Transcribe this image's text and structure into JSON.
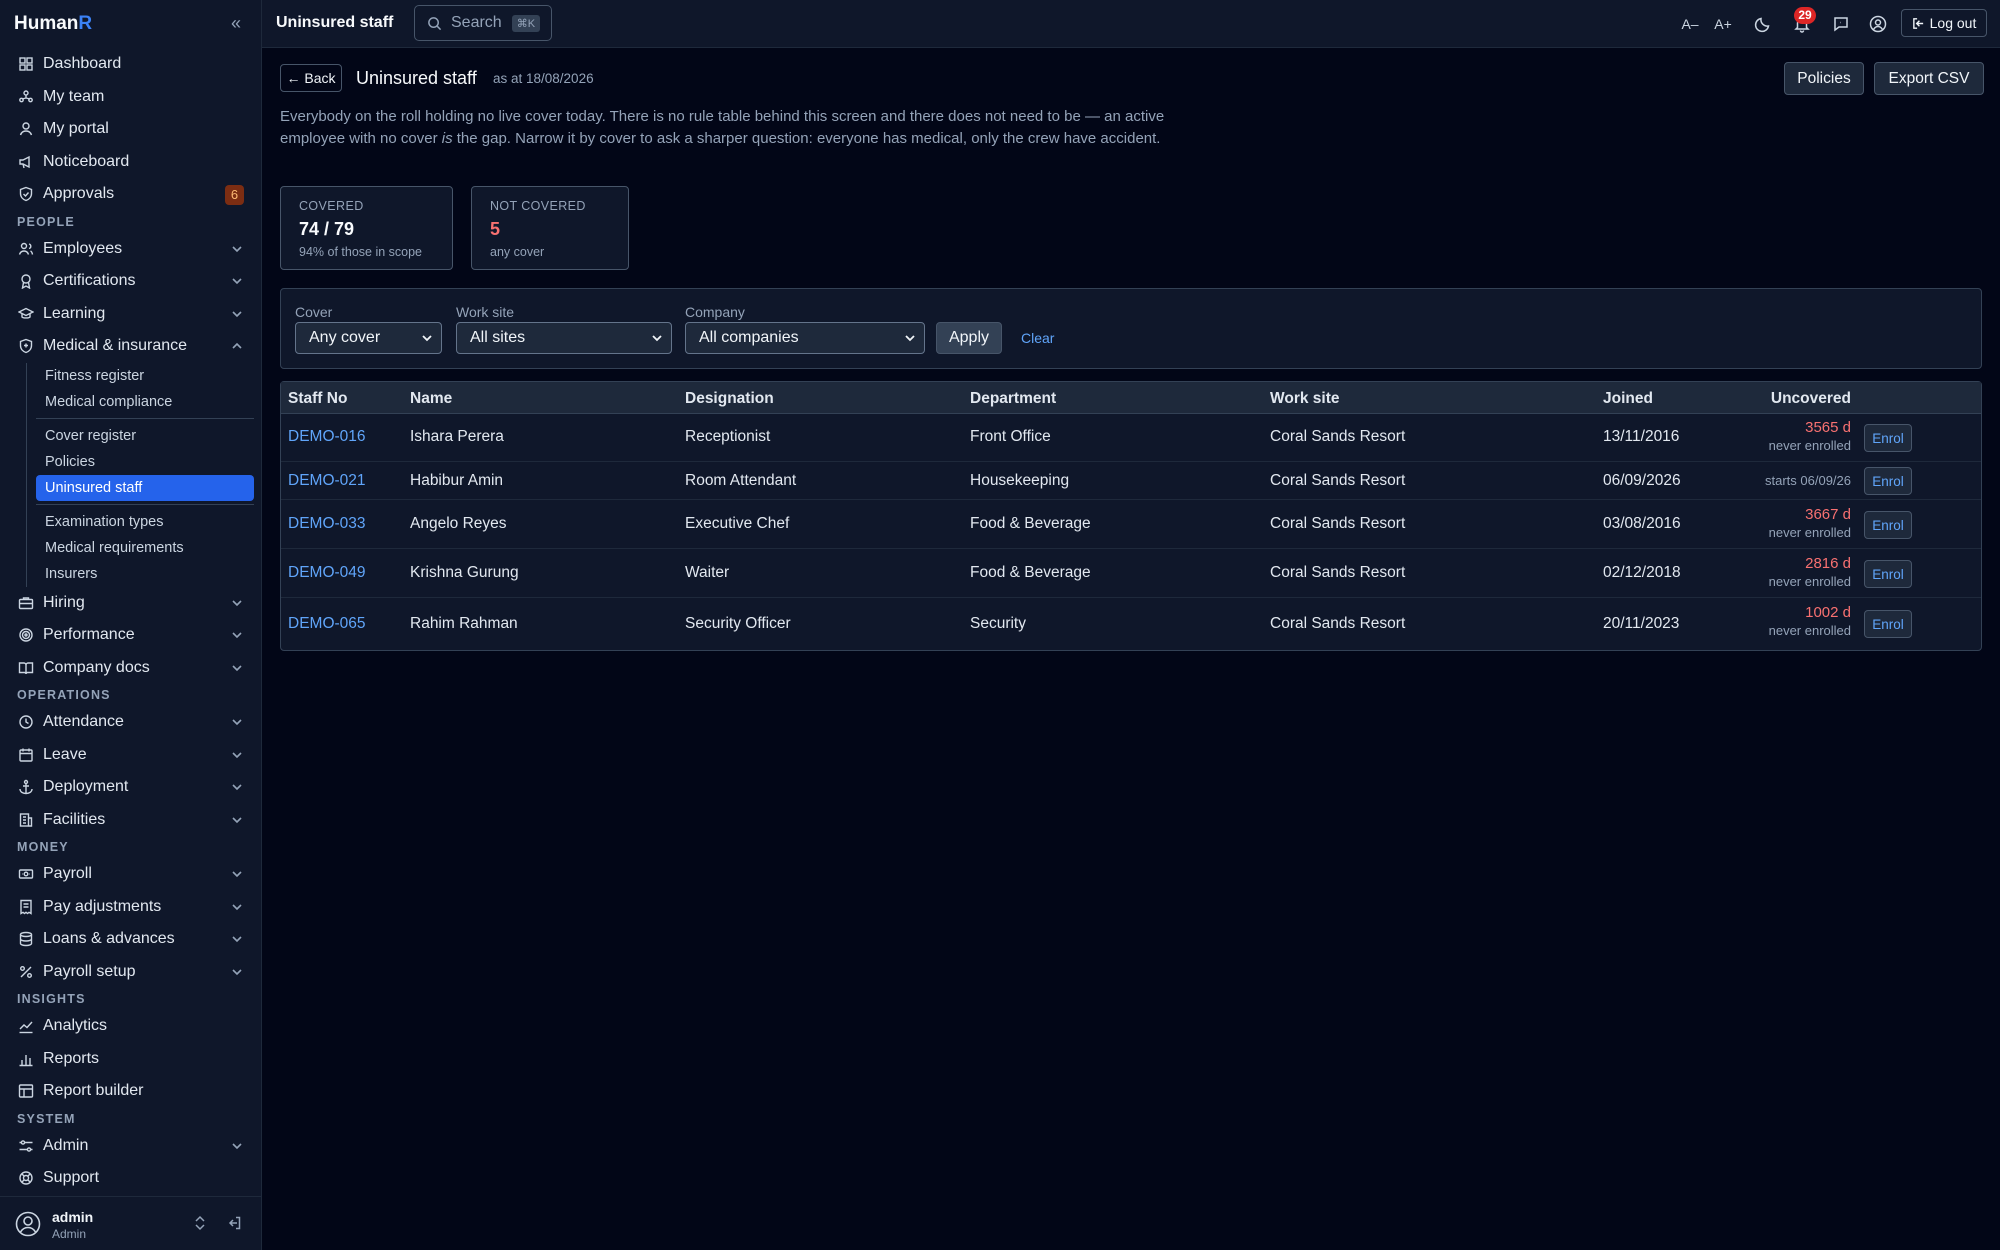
{
  "app": {
    "brand_main": "Human",
    "brand_accent": "R"
  },
  "sidebar": {
    "items_top": [
      {
        "label": "Dashboard",
        "icon": "grid-icon"
      },
      {
        "label": "My team",
        "icon": "team-icon"
      },
      {
        "label": "My portal",
        "icon": "user-icon"
      },
      {
        "label": "Noticeboard",
        "icon": "megaphone-icon"
      },
      {
        "label": "Approvals",
        "icon": "shield-check-icon",
        "badge": "6"
      }
    ],
    "sections": {
      "people": "PEOPLE",
      "operations": "OPERATIONS",
      "money": "MONEY",
      "insights": "INSIGHTS",
      "system": "SYSTEM"
    },
    "people_items": [
      {
        "label": "Employees"
      },
      {
        "label": "Certifications"
      },
      {
        "label": "Learning"
      },
      {
        "label": "Medical & insurance"
      }
    ],
    "medical_sub": [
      "Fitness register",
      "Medical compliance",
      "Cover register",
      "Policies",
      "Uninsured staff",
      "Examination types",
      "Medical requirements",
      "Insurers"
    ],
    "people_items_after": [
      {
        "label": "Hiring"
      },
      {
        "label": "Performance"
      },
      {
        "label": "Company docs"
      }
    ],
    "operations_items": [
      {
        "label": "Attendance"
      },
      {
        "label": "Leave"
      },
      {
        "label": "Deployment"
      },
      {
        "label": "Facilities"
      }
    ],
    "money_items": [
      {
        "label": "Payroll"
      },
      {
        "label": "Pay adjustments"
      },
      {
        "label": "Loans & advances"
      },
      {
        "label": "Payroll setup"
      }
    ],
    "insights_items": [
      {
        "label": "Analytics"
      },
      {
        "label": "Reports"
      },
      {
        "label": "Report builder"
      }
    ],
    "system_items": [
      {
        "label": "Admin"
      },
      {
        "label": "Support"
      }
    ],
    "user": {
      "name": "admin",
      "role": "Admin"
    }
  },
  "topbar": {
    "title": "Uninsured staff",
    "search_label": "Search",
    "search_kbd": "⌘K",
    "font_decrease": "A–",
    "font_increase": "A+",
    "notifications_count": "29",
    "logout_label": "Log out"
  },
  "page": {
    "back_label": "← Back",
    "title": "Uninsured staff",
    "as_at": "as at 18/08/2026",
    "policies_label": "Policies",
    "export_label": "Export CSV",
    "intro_a": "Everybody on the roll holding no live cover today. There is no rule table behind this screen and there does not need to be — an active employee with no cover ",
    "intro_em": "is",
    "intro_b": " the gap. Narrow it by cover to ask a sharper question: everyone has medical, only the crew have accident."
  },
  "stats": {
    "covered": {
      "label": "COVERED",
      "value": "74 / 79",
      "sub": "94% of those in scope"
    },
    "not_covered": {
      "label": "NOT COVERED",
      "value": "5",
      "sub": "any cover"
    }
  },
  "filters": {
    "cover": {
      "label": "Cover",
      "value": "Any cover"
    },
    "work_site": {
      "label": "Work site",
      "value": "All sites"
    },
    "company": {
      "label": "Company",
      "value": "All companies"
    },
    "apply_label": "Apply",
    "clear_label": "Clear"
  },
  "table": {
    "headers": {
      "staff_no": "Staff No",
      "name": "Name",
      "designation": "Designation",
      "department": "Department",
      "work_site": "Work site",
      "joined": "Joined",
      "uncovered": "Uncovered"
    },
    "enrol_label": "Enrol",
    "rows": [
      {
        "staff_no": "DEMO-016",
        "name": "Ishara Perera",
        "designation": "Receptionist",
        "department": "Front Office",
        "work_site": "Coral Sands Resort",
        "joined": "13/11/2016",
        "days": "3565 d",
        "note": "never enrolled"
      },
      {
        "staff_no": "DEMO-021",
        "name": "Habibur Amin",
        "designation": "Room Attendant",
        "department": "Housekeeping",
        "work_site": "Coral Sands Resort",
        "joined": "06/09/2026",
        "starts": "starts 06/09/26"
      },
      {
        "staff_no": "DEMO-033",
        "name": "Angelo Reyes",
        "designation": "Executive Chef",
        "department": "Food & Beverage",
        "work_site": "Coral Sands Resort",
        "joined": "03/08/2016",
        "days": "3667 d",
        "note": "never enrolled"
      },
      {
        "staff_no": "DEMO-049",
        "name": "Krishna Gurung",
        "designation": "Waiter",
        "department": "Food & Beverage",
        "work_site": "Coral Sands Resort",
        "joined": "02/12/2018",
        "days": "2816 d",
        "note": "never enrolled"
      },
      {
        "staff_no": "DEMO-065",
        "name": "Rahim Rahman",
        "designation": "Security Officer",
        "department": "Security",
        "work_site": "Coral Sands Resort",
        "joined": "20/11/2023",
        "days": "1002 d",
        "note": "never enrolled"
      }
    ]
  }
}
